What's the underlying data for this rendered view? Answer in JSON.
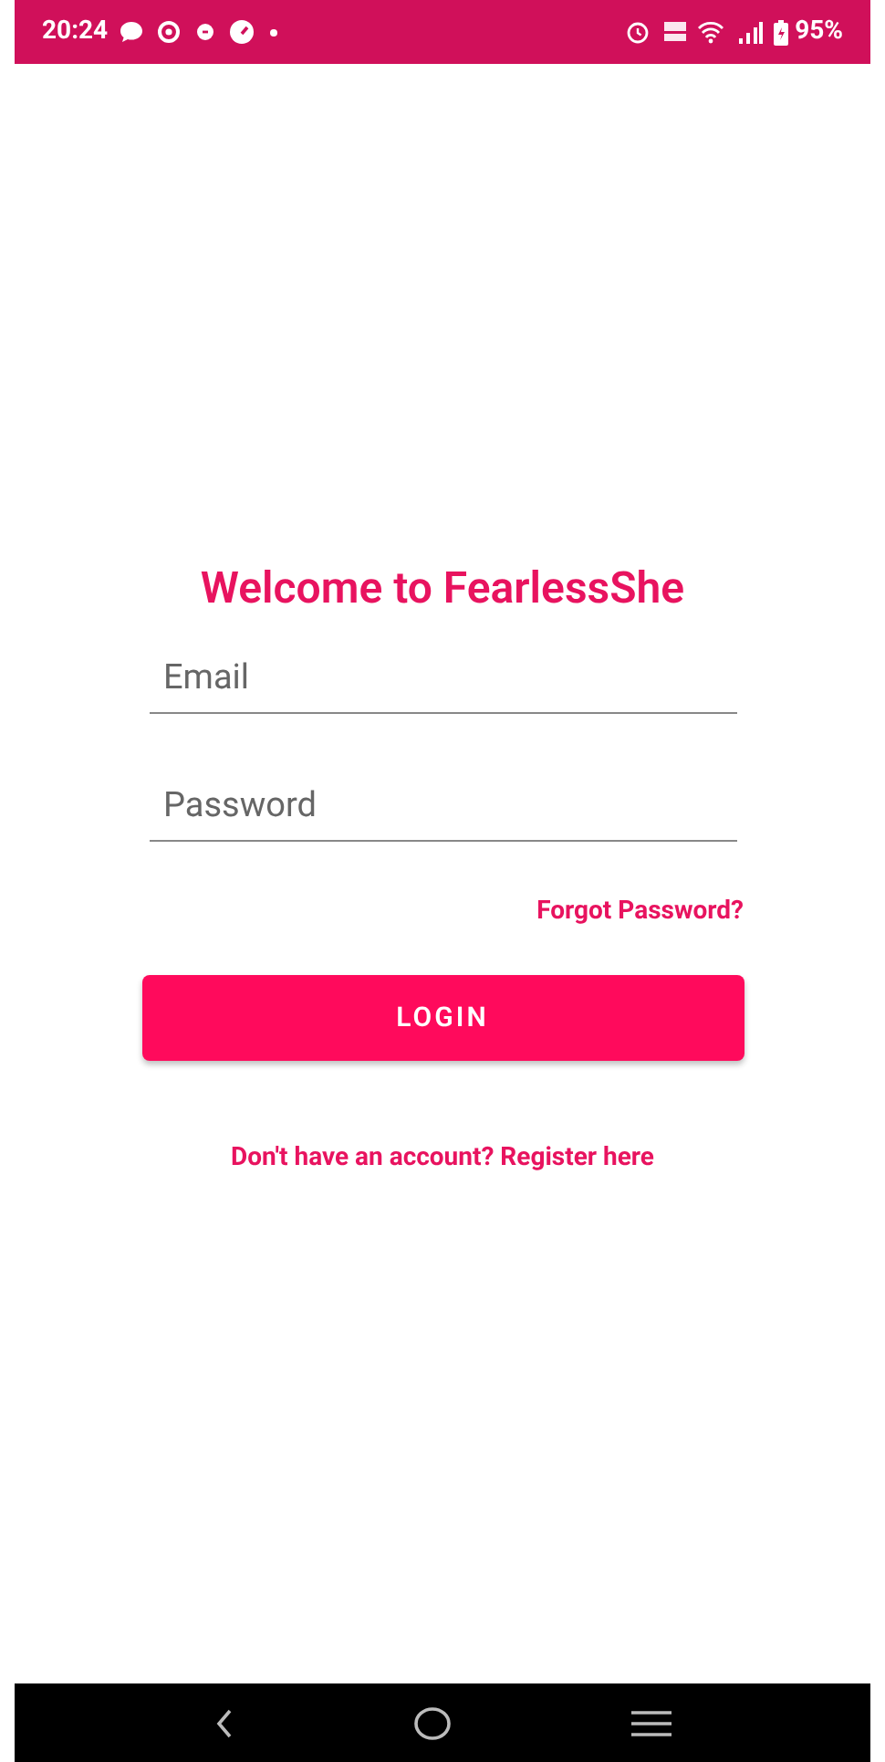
{
  "status_bar": {
    "time": "20:24",
    "battery": "95%"
  },
  "title": "Welcome to FearlessShe",
  "fields": [
    {
      "placeholder": "Email"
    },
    {
      "placeholder": "Password"
    }
  ],
  "forgot_link": "Forgot Password?",
  "login_button": "LOGIN",
  "register_link": "Don't have an account? Register here"
}
